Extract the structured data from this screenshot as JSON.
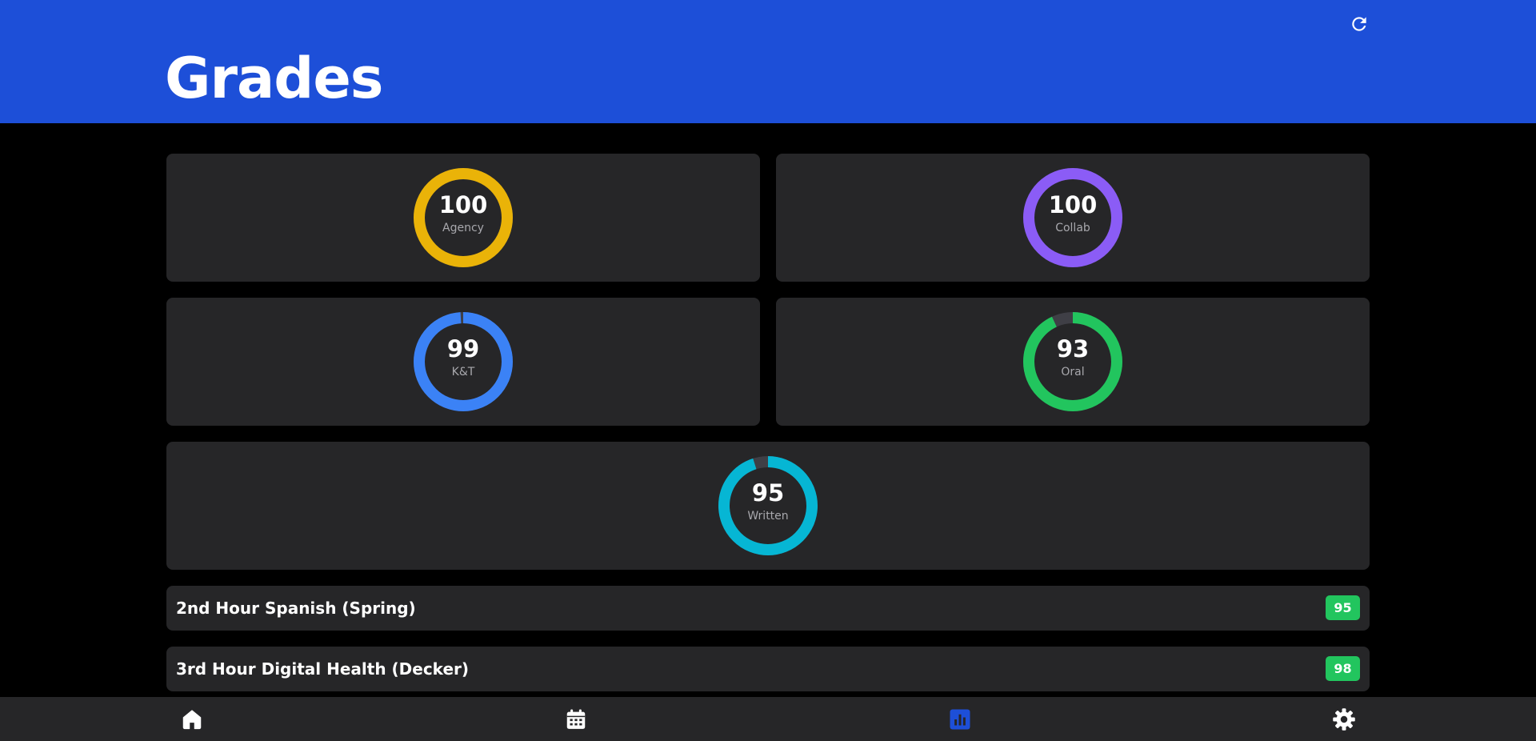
{
  "header": {
    "title": "Grades",
    "background": "#1d4fd8",
    "refresh_icon": "refresh-icon"
  },
  "skills": [
    {
      "label": "Agency",
      "value": "100",
      "score": 100,
      "color": "#eab308"
    },
    {
      "label": "Collab",
      "value": "100",
      "score": 100,
      "color": "#8b5cf6"
    },
    {
      "label": "K&T",
      "value": "99",
      "score": 99,
      "color": "#3b82f6"
    },
    {
      "label": "Oral",
      "value": "93",
      "score": 93,
      "color": "#22c55e"
    },
    {
      "label": "Written",
      "value": "95",
      "score": 95,
      "color": "#06b6d4"
    }
  ],
  "ring_track_color": "#3f3f46",
  "courses": [
    {
      "name": "2nd Hour Spanish (Spring)",
      "grade": "95"
    },
    {
      "name": "3rd Hour Digital Health (Decker)",
      "grade": "98"
    }
  ],
  "grade_badge_color": "#22c55e",
  "nav": {
    "items": [
      {
        "icon": "home-icon",
        "active": false
      },
      {
        "icon": "calendar-icon",
        "active": false
      },
      {
        "icon": "grades-chart-icon",
        "active": true
      },
      {
        "icon": "gear-icon",
        "active": false
      }
    ],
    "active_color": "#1d4fd8"
  }
}
